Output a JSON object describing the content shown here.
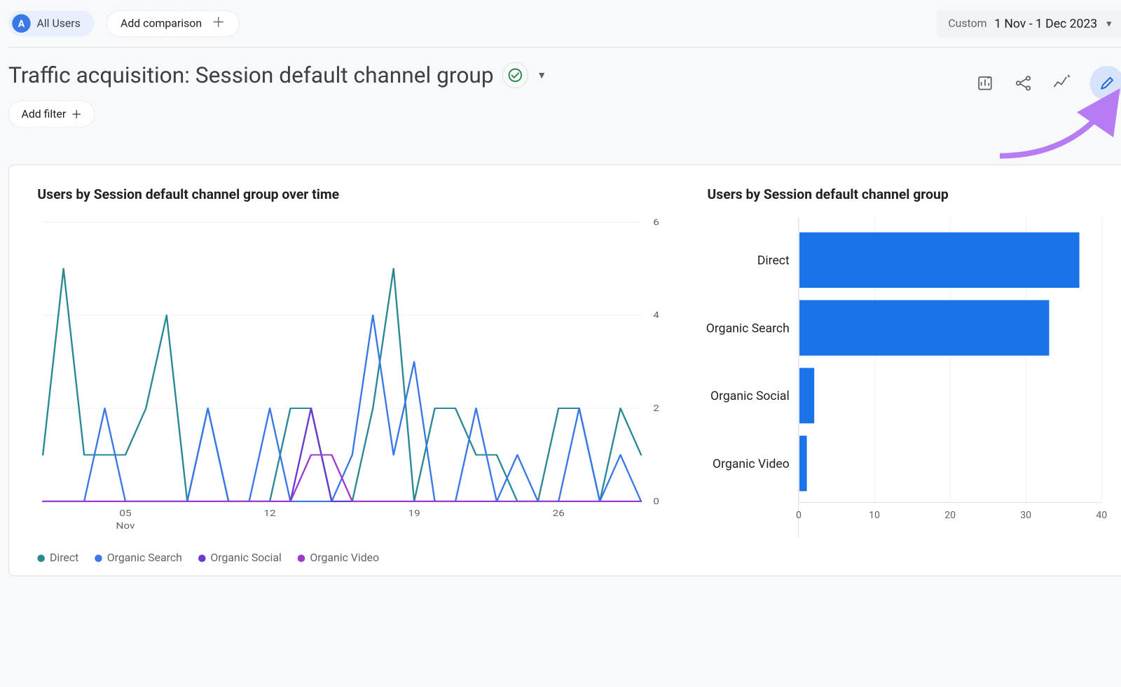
{
  "topbar": {
    "badge_letter": "A",
    "all_users_label": "All Users",
    "add_comparison_label": "Add comparison",
    "date_custom_label": "Custom",
    "date_range_label": "1 Nov - 1 Dec 2023"
  },
  "title": {
    "page_title": "Traffic acquisition: Session default channel group",
    "add_filter_label": "Add filter"
  },
  "colors": {
    "direct": "#2a8a94",
    "organic_search": "#3b78e7",
    "organic_social": "#6a3ad1",
    "organic_video": "#a03acb",
    "bar_fill": "#1a73e8"
  },
  "chart_data": [
    {
      "type": "line",
      "title": "Users by Session default channel group over time",
      "xlabel": "",
      "ylabel": "",
      "ylim": [
        0,
        6
      ],
      "x": [
        1,
        2,
        3,
        4,
        5,
        6,
        7,
        8,
        9,
        10,
        11,
        12,
        13,
        14,
        15,
        16,
        17,
        18,
        19,
        20,
        21,
        22,
        23,
        24,
        25,
        26,
        27,
        28,
        29,
        30
      ],
      "x_ticks": [
        5,
        12,
        19,
        26
      ],
      "x_tick_labels": [
        "05",
        "12",
        "19",
        "26"
      ],
      "x_unit_label": "Nov",
      "y_ticks": [
        0,
        2,
        4,
        6
      ],
      "series": [
        {
          "name": "Direct",
          "color_key": "direct",
          "values": [
            1,
            5,
            1,
            1,
            1,
            2,
            4,
            0,
            2,
            0,
            0,
            0,
            2,
            2,
            0,
            0,
            2,
            5,
            0,
            2,
            2,
            1,
            1,
            0,
            0,
            2,
            2,
            0,
            2,
            1
          ]
        },
        {
          "name": "Organic Search",
          "color_key": "organic_search",
          "values": [
            0,
            0,
            0,
            2,
            0,
            0,
            0,
            0,
            2,
            0,
            0,
            2,
            0,
            0,
            0,
            1,
            4,
            1,
            3,
            0,
            0,
            2,
            0,
            1,
            0,
            0,
            2,
            0,
            1,
            0
          ]
        },
        {
          "name": "Organic Social",
          "color_key": "organic_social",
          "values": [
            0,
            0,
            0,
            0,
            0,
            0,
            0,
            0,
            0,
            0,
            0,
            0,
            0,
            2,
            0,
            0,
            0,
            0,
            0,
            0,
            0,
            0,
            0,
            0,
            0,
            0,
            0,
            0,
            0,
            0
          ]
        },
        {
          "name": "Organic Video",
          "color_key": "organic_video",
          "values": [
            0,
            0,
            0,
            0,
            0,
            0,
            0,
            0,
            0,
            0,
            0,
            0,
            0,
            1,
            1,
            0,
            0,
            0,
            0,
            0,
            0,
            0,
            0,
            0,
            0,
            0,
            0,
            0,
            0,
            0
          ]
        }
      ],
      "legend": [
        "Direct",
        "Organic Search",
        "Organic Social",
        "Organic Video"
      ]
    },
    {
      "type": "bar",
      "title": "Users by Session default channel group",
      "orientation": "horizontal",
      "categories": [
        "Direct",
        "Organic Search",
        "Organic Social",
        "Organic Video"
      ],
      "values": [
        37,
        33,
        2,
        1
      ],
      "xlim": [
        0,
        40
      ],
      "x_ticks": [
        0,
        10,
        20,
        30,
        40
      ]
    }
  ]
}
